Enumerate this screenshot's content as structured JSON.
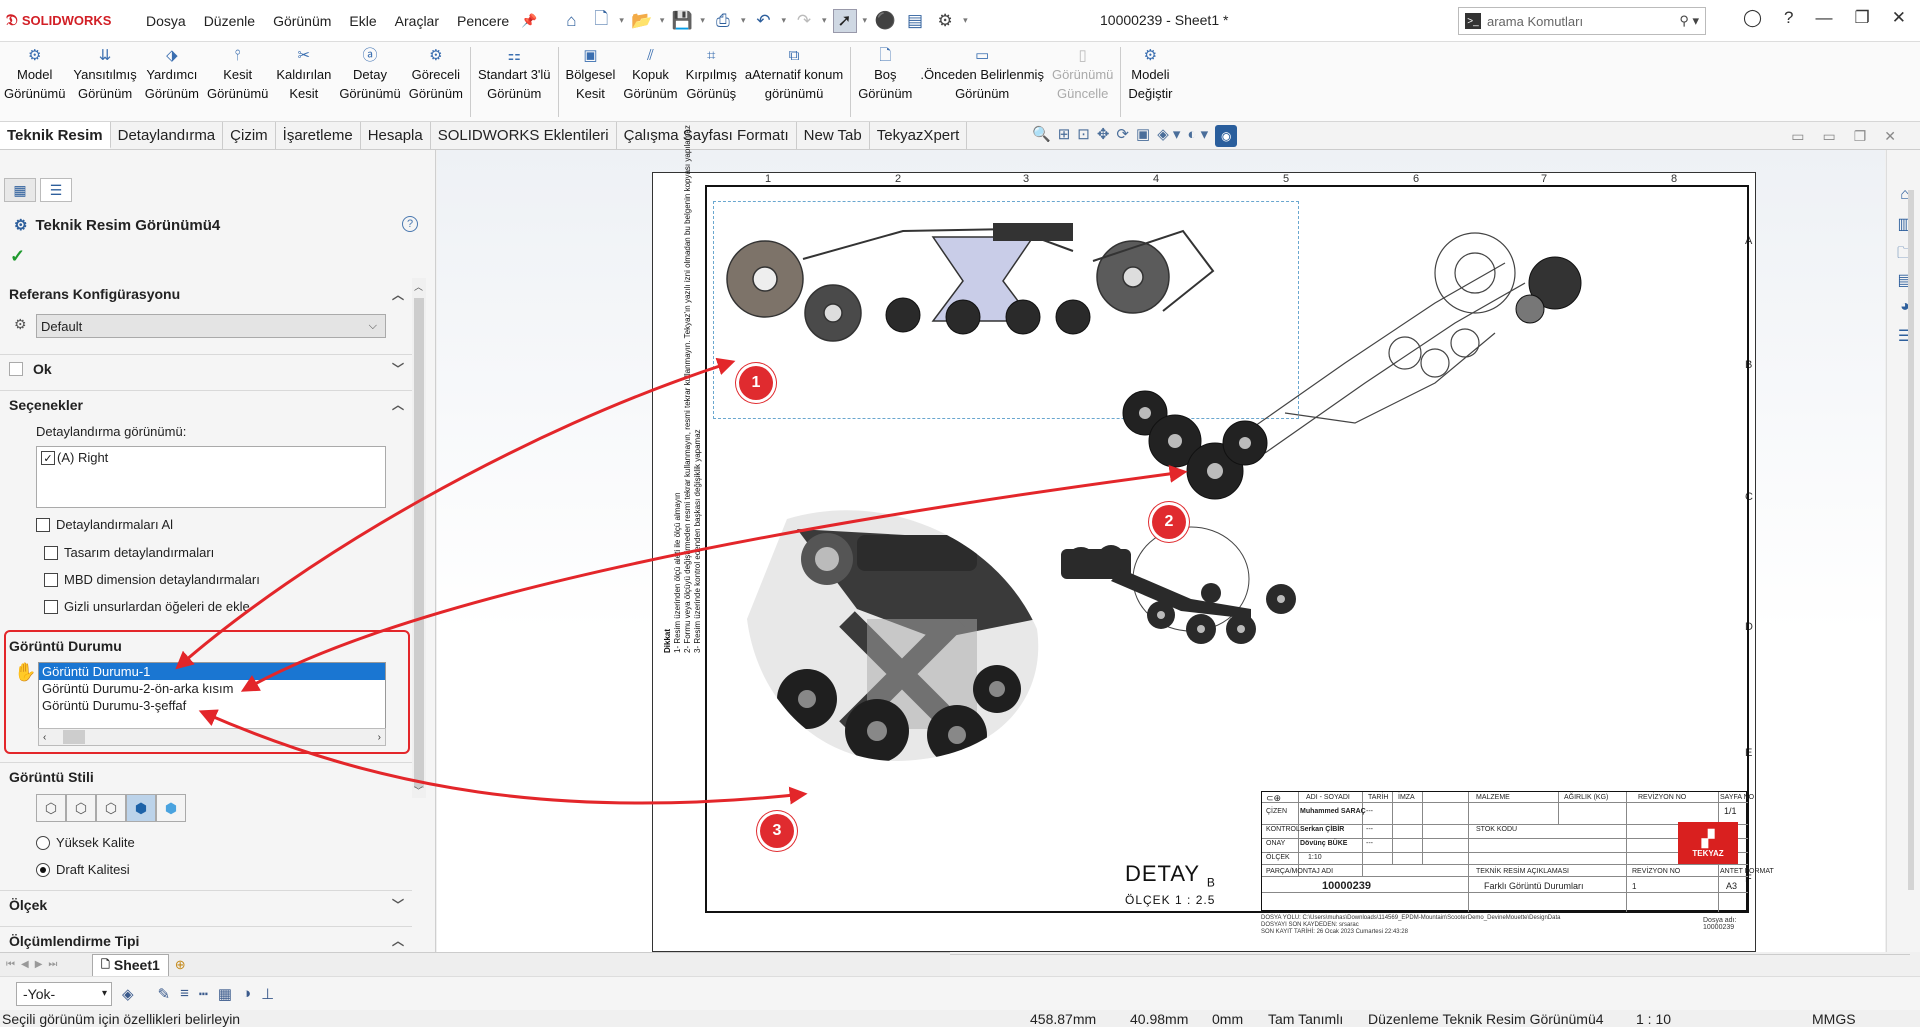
{
  "app": {
    "logo_text": "SOLIDWORKS",
    "document_title": "10000239 - Sheet1 *"
  },
  "menu": [
    "Dosya",
    "Düzenle",
    "Görünüm",
    "Ekle",
    "Araçlar",
    "Pencere"
  ],
  "search": {
    "placeholder": "arama Komutları"
  },
  "commands": [
    {
      "l1": "Model",
      "l2": "Görünümü",
      "icon": "model-view-icon"
    },
    {
      "l1": "Yansıtılmış",
      "l2": "Görünüm",
      "icon": "projected-view-icon"
    },
    {
      "l1": "Yardımcı",
      "l2": "Görünüm",
      "icon": "auxiliary-view-icon"
    },
    {
      "l1": "Kesit",
      "l2": "Görünümü",
      "icon": "section-view-icon"
    },
    {
      "l1": "Kaldırılan",
      "l2": "Kesit",
      "icon": "removed-section-icon"
    },
    {
      "l1": "Detay",
      "l2": "Görünümü",
      "icon": "detail-view-icon"
    },
    {
      "l1": "Göreceli",
      "l2": "Görünüm",
      "icon": "relative-view-icon"
    },
    {
      "l1": "Standart 3'lü",
      "l2": "Görünüm",
      "icon": "standard-3-view-icon"
    },
    {
      "l1": "Bölgesel",
      "l2": "Kesit",
      "icon": "broken-out-section-icon"
    },
    {
      "l1": "Kopuk",
      "l2": "Görünüm",
      "icon": "break-view-icon"
    },
    {
      "l1": "Kırpılmış",
      "l2": "Görünüş",
      "icon": "crop-view-icon"
    },
    {
      "l1": "aAternatif konum",
      "l2": "görünümü",
      "icon": "alternate-position-icon"
    },
    {
      "l1": "Boş",
      "l2": "Görünüm",
      "icon": "empty-view-icon"
    },
    {
      "l1": ".Önceden Belirlenmiş",
      "l2": "Görünüm",
      "icon": "predefined-view-icon"
    },
    {
      "l1": "Görünümü",
      "l2": "Güncelle",
      "icon": "update-view-icon",
      "disabled": true
    },
    {
      "l1": "Modeli",
      "l2": "Değiştir",
      "icon": "replace-model-icon"
    }
  ],
  "tabs": [
    "Teknik Resim",
    "Detaylandırma",
    "Çizim",
    "İşaretleme",
    "Hesapla",
    "SOLIDWORKS Eklentileri",
    "Çalışma Sayfası Formatı",
    "New Tab",
    "TekyazXpert"
  ],
  "panel": {
    "title": "Teknik Resim Görünümü4",
    "ref_config_header": "Referans Konfigürasyonu",
    "ref_config_value": "Default",
    "arrow_header": "Ok",
    "options_header": "Seçenekler",
    "detail_view_label": "Detaylandırma görünümü:",
    "detail_view_item": "(A) Right",
    "import_annotations": "Detaylandırmaları Al",
    "design_annotations": "Tasarım detaylandırmaları",
    "mbd_annotations": "MBD dimension detaylandırmaları",
    "hidden_features": "Gizli unsurlardan öğeleri de ekle",
    "display_state_header": "Görüntü Durumu",
    "display_states": [
      "Görüntü Durumu-1",
      "Görüntü Durumu-2-ön-arka kısım",
      "Görüntü Durumu-3-şeffaf"
    ],
    "display_style_header": "Görüntü Stili",
    "high_quality": "Yüksek Kalite",
    "draft_quality": "Draft Kalitesi",
    "scale_header": "Ölçek",
    "dim_type_header": "Ölçümlendirme Tipi"
  },
  "sheet_tab": "Sheet1",
  "layer": "-Yok-",
  "drawing": {
    "zones_top": [
      "1",
      "2",
      "3",
      "4",
      "5",
      "6",
      "7",
      "8"
    ],
    "zones_side": [
      "A",
      "B",
      "C",
      "D",
      "E",
      "F"
    ],
    "note_lines": [
      "Dikkat",
      "1- Resim üzerinden ölçü aleti ile ölçü almayın",
      "2- Formu veya ölçüyü değiştirmeden resmi tekrar kullanmayın, resmi tekrar kullanmayın. Tekyaz'ın yazılı izni olmadan bu belgenin kopyası yapılamaz",
      "3- Resim üzerinde kontrol edenden başkası değişiklik yapamaz"
    ],
    "detail_label": "DETAY",
    "detail_letter": "B",
    "detail_scale": "ÖLÇEK  1 : 2.5",
    "badges": [
      "1",
      "2",
      "3"
    ],
    "title_block": {
      "h_name": "ADI - SOYADI",
      "h_date": "TARİH",
      "h_sign": "İMZA",
      "h_material": "MALZEME",
      "h_weight": "AĞIRLIK (KG)",
      "h_revision": "REVİZYON NO",
      "h_sheet": "SAYFA NO",
      "sheet_value": "1/1",
      "drawn_label": "ÇİZEN",
      "drawn_by": "Muhammed SARAÇ",
      "control_label": "KONTROL",
      "control_by": "Serkan ÇİBİR",
      "approve_label": "ONAY",
      "approve_by": "Dövünç BÜKE",
      "scale_label": "ÖLÇEK",
      "scale_value": "1:10",
      "stock_label": "STOK KODU",
      "part_label": "PARÇA/MONTAJ ADI",
      "part_no": "10000239",
      "desc_label": "TEKNİK RESİM AÇIKLAMASI",
      "desc_value": "Farklı Görüntü Durumları",
      "rev_label": "REVİZYON NO",
      "rev_value": "1",
      "format_label": "ANTET FORMAT",
      "format_value": "A3",
      "logo": "TEKYAZ",
      "dash": "---"
    },
    "doc_path": "DOSYA YOLU: C:\\Users\\muhas\\Downloads\\114569_EPDM-Mountain\\ScooterDemo_DevineMouette\\DesignData",
    "saved_by": "DOSYAYI SON KAYDEDEN: srsarac",
    "saved_date": "SON KAYIT TARİHİ: 26 Ocak 2023 Cumartesi 22:43:28",
    "doc_name": "Dosya adı: 10000239"
  },
  "status": {
    "message": "Seçili görünüm için özellikleri belirleyin",
    "x": "458.87mm",
    "y": "40.98mm",
    "z": "0mm",
    "state": "Tam Tanımlı",
    "edit": "Düzenleme Teknik Resim Görünümü4",
    "scale": "1 : 10",
    "units": "MMGS"
  },
  "colors": {
    "accent": "#1a76d2",
    "callout_red": "#e02b2f",
    "brand_red": "#d21f26"
  }
}
